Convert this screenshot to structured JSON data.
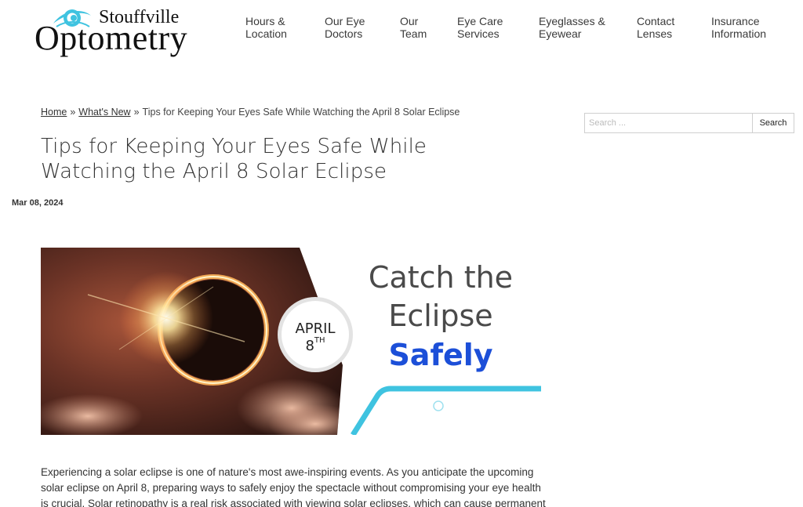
{
  "header": {
    "logo_top": "Stouffville",
    "logo_main": "Optometry"
  },
  "nav": [
    {
      "line1": "Hours &",
      "line2": "Location"
    },
    {
      "line1": "Our Eye",
      "line2": "Doctors"
    },
    {
      "line1": "Our",
      "line2": "Team"
    },
    {
      "line1": "Eye Care",
      "line2": "Services"
    },
    {
      "line1": "Eyeglasses &",
      "line2": "Eyewear"
    },
    {
      "line1": "Contact",
      "line2": "Lenses"
    },
    {
      "line1": "Insurance",
      "line2": "Information"
    }
  ],
  "breadcrumb": {
    "home": "Home",
    "sep1": "»",
    "whats_new": "What's New",
    "sep2": "»",
    "current": "Tips for Keeping Your Eyes Safe While Watching the April 8 Solar Eclipse"
  },
  "search": {
    "placeholder": "Search ...",
    "button": "Search"
  },
  "article": {
    "title": "Tips for Keeping Your Eyes Safe While Watching the April 8 Solar Eclipse",
    "date": "Mar 08, 2024",
    "hero": {
      "line1": "Catch the",
      "line2": "Eclipse",
      "line3": "Safely",
      "badge_month": "APRIL",
      "badge_day": "8",
      "badge_suffix": "TH"
    },
    "body": "Experiencing a solar eclipse is one of nature's most awe-inspiring events. As you anticipate the upcoming solar eclipse on April 8, preparing ways to safely enjoy the spectacle without compromising your eye health is crucial. Solar retinopathy is a real risk associated with viewing solar eclipses, which can cause permanent damage to"
  },
  "colors": {
    "accent_blue": "#1c4fd8",
    "accent_cyan": "#3fc3e0"
  }
}
